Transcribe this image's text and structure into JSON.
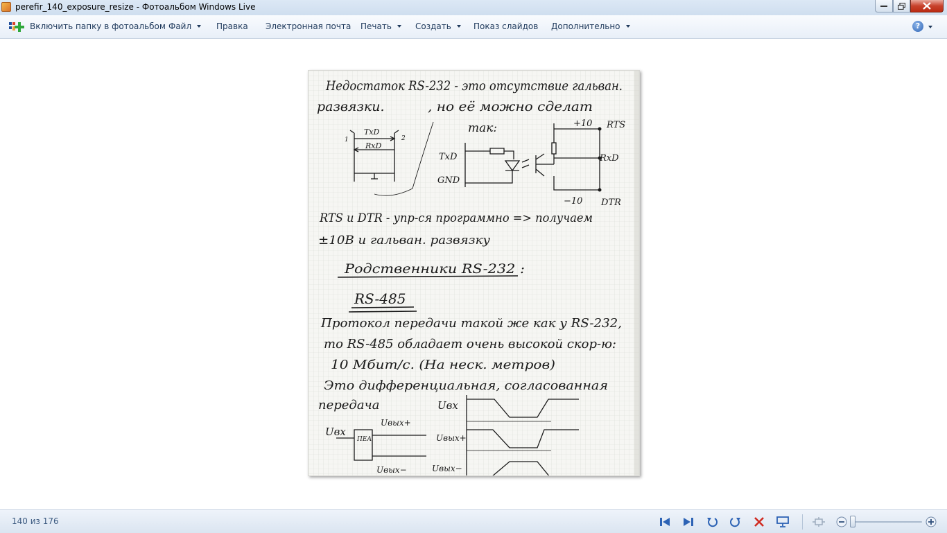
{
  "window": {
    "title": "perefir_140_exposure_resize - Фотоальбом Windows Live"
  },
  "menu": {
    "add_folder": "Включить папку в фотоальбом",
    "file": "Файл",
    "edit": "Правка",
    "email": "Электронная почта",
    "print": "Печать",
    "create": "Создать",
    "slideshow": "Показ слайдов",
    "more": "Дополнительно",
    "help_icon": "?"
  },
  "photo": {
    "handwriting": {
      "line1": "Недостаток RS-232 - это отсутствие гальван.",
      "line2a": "развязки.",
      "line2b": ", но её можно сделат",
      "line3": "так:",
      "d_txd1": "TxD",
      "d_rxd1": "RxD",
      "d_num1": "1",
      "d_num2": "2",
      "d_txd2": "TxD",
      "d_gnd": "GND",
      "d_plus10": "+10",
      "d_rts": "RTS",
      "d_rxd2": "RxD",
      "d_minus10": "−10",
      "d_dtr": "DTR",
      "line4": "RTS и DTR - упр-ся программно => получаем",
      "line5": "±10В и гальван. развязку",
      "heading1": "Родственники RS-232 :",
      "heading2": "RS-485",
      "line6": "Протокол передачи такой же как у RS-232,",
      "line7": "то RS-485 обладает очень высокой скор-ю:",
      "line8": "10 Мбит/с. (На неск. метров)",
      "line9": "Это дифференциальная, согласованная",
      "line10": "передача",
      "w_uvx1": "Uвх",
      "w_uvx2": "Uвх",
      "w_pea": "ПЕА",
      "w_uvyh_plus": "Uвых+",
      "w_uvyh_minus": "Uвых−",
      "w_uvyh_plus2": "Uвых+",
      "w_uvyh_minus2": "Uвых−"
    }
  },
  "status": {
    "counter": "140 из 176"
  },
  "colors": {
    "chrome": "#dce8f5",
    "ink": "#1a1a1a",
    "accent_blue": "#2d63b5",
    "delete_red": "#d02a20"
  }
}
